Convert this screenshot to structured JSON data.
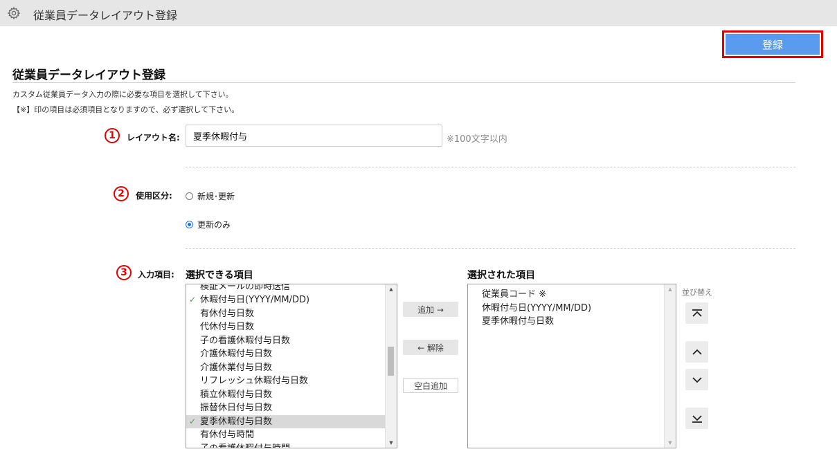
{
  "header": {
    "title": "従業員データレイアウト登録",
    "icon": "gear-icon"
  },
  "toolbar": {
    "register_label": "登録"
  },
  "page": {
    "title": "従業員データレイアウト登録",
    "desc1": "カスタム従業員データ入力の際に必要な項目を選択して下さい。",
    "desc2": "【※】印の項目は必須項目となりますので、必ず選択して下さい。"
  },
  "markers": [
    "1",
    "2",
    "3"
  ],
  "layout_name": {
    "label": "レイアウト名:",
    "value": "夏季休暇付与",
    "hint": "※100文字以内"
  },
  "usage": {
    "label": "使用区分:",
    "options": [
      {
        "label": "新規･更新",
        "selected": false
      },
      {
        "label": "更新のみ",
        "selected": true
      }
    ]
  },
  "input_items": {
    "label": "入力項目:",
    "available_title": "選択できる項目",
    "selected_title": "選択された項目",
    "available": [
      {
        "label": "検証メールの即時送信",
        "checked": false,
        "highlight": false
      },
      {
        "label": "休暇付与日(YYYY/MM/DD)",
        "checked": true,
        "highlight": false
      },
      {
        "label": "有休付与日数",
        "checked": false,
        "highlight": false
      },
      {
        "label": "代休付与日数",
        "checked": false,
        "highlight": false
      },
      {
        "label": "子の看護休暇付与日数",
        "checked": false,
        "highlight": false
      },
      {
        "label": "介護休暇付与日数",
        "checked": false,
        "highlight": false
      },
      {
        "label": "介護休業付与日数",
        "checked": false,
        "highlight": false
      },
      {
        "label": "リフレッシュ休暇付与日数",
        "checked": false,
        "highlight": false
      },
      {
        "label": "積立休暇付与日数",
        "checked": false,
        "highlight": false
      },
      {
        "label": "振替休日付与日数",
        "checked": false,
        "highlight": false
      },
      {
        "label": "夏季休暇付与日数",
        "checked": true,
        "highlight": true
      },
      {
        "label": "有休付与時間",
        "checked": false,
        "highlight": false
      },
      {
        "label": "子の看護休暇付与時間",
        "checked": false,
        "highlight": false
      }
    ],
    "selected": [
      "従業員コード ※",
      "休暇付与日(YYYY/MM/DD)",
      "夏季休暇付与日数"
    ],
    "add_label": "追加 →",
    "remove_label": "← 解除",
    "blank_label": "空白追加",
    "sort_label": "並び替え"
  },
  "colors": {
    "accent": "#5b9bef",
    "highlight_border": "#e00000",
    "check": "#3aa34a"
  }
}
